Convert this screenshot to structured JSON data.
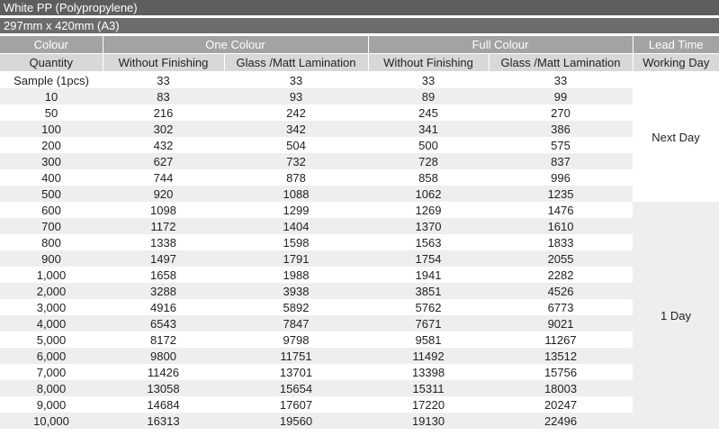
{
  "header": {
    "material": "White PP (Polypropylene)",
    "size": "297mm x 420mm (A3)"
  },
  "columns": {
    "colour_label": "Colour",
    "one_colour": "One Colour",
    "full_colour": "Full Colour",
    "lead_time": "Lead Time",
    "quantity": "Quantity",
    "without_finishing": "Without Finishing",
    "lamination": "Glass /Matt Lamination",
    "working_day": "Working Day"
  },
  "rows": [
    {
      "qty": "Sample (1pcs)",
      "one_plain": "33",
      "one_lam": "33",
      "full_plain": "33",
      "full_lam": "33"
    },
    {
      "qty": "10",
      "one_plain": "83",
      "one_lam": "93",
      "full_plain": "89",
      "full_lam": "99"
    },
    {
      "qty": "50",
      "one_plain": "216",
      "one_lam": "242",
      "full_plain": "245",
      "full_lam": "270"
    },
    {
      "qty": "100",
      "one_plain": "302",
      "one_lam": "342",
      "full_plain": "341",
      "full_lam": "386"
    },
    {
      "qty": "200",
      "one_plain": "432",
      "one_lam": "504",
      "full_plain": "500",
      "full_lam": "575"
    },
    {
      "qty": "300",
      "one_plain": "627",
      "one_lam": "732",
      "full_plain": "728",
      "full_lam": "837"
    },
    {
      "qty": "400",
      "one_plain": "744",
      "one_lam": "878",
      "full_plain": "858",
      "full_lam": "996"
    },
    {
      "qty": "500",
      "one_plain": "920",
      "one_lam": "1088",
      "full_plain": "1062",
      "full_lam": "1235"
    },
    {
      "qty": "600",
      "one_plain": "1098",
      "one_lam": "1299",
      "full_plain": "1269",
      "full_lam": "1476"
    },
    {
      "qty": "700",
      "one_plain": "1172",
      "one_lam": "1404",
      "full_plain": "1370",
      "full_lam": "1610"
    },
    {
      "qty": "800",
      "one_plain": "1338",
      "one_lam": "1598",
      "full_plain": "1563",
      "full_lam": "1833"
    },
    {
      "qty": "900",
      "one_plain": "1497",
      "one_lam": "1791",
      "full_plain": "1754",
      "full_lam": "2055"
    },
    {
      "qty": "1,000",
      "one_plain": "1658",
      "one_lam": "1988",
      "full_plain": "1941",
      "full_lam": "2282"
    },
    {
      "qty": "2,000",
      "one_plain": "3288",
      "one_lam": "3938",
      "full_plain": "3851",
      "full_lam": "4526"
    },
    {
      "qty": "3,000",
      "one_plain": "4916",
      "one_lam": "5892",
      "full_plain": "5762",
      "full_lam": "6773"
    },
    {
      "qty": "4,000",
      "one_plain": "6543",
      "one_lam": "7847",
      "full_plain": "7671",
      "full_lam": "9021"
    },
    {
      "qty": "5,000",
      "one_plain": "8172",
      "one_lam": "9798",
      "full_plain": "9581",
      "full_lam": "11267"
    },
    {
      "qty": "6,000",
      "one_plain": "9800",
      "one_lam": "11751",
      "full_plain": "11492",
      "full_lam": "13512"
    },
    {
      "qty": "7,000",
      "one_plain": "11426",
      "one_lam": "13701",
      "full_plain": "13398",
      "full_lam": "15756"
    },
    {
      "qty": "8,000",
      "one_plain": "13058",
      "one_lam": "15654",
      "full_plain": "15311",
      "full_lam": "18003"
    },
    {
      "qty": "9,000",
      "one_plain": "14684",
      "one_lam": "17607",
      "full_plain": "17220",
      "full_lam": "20247"
    },
    {
      "qty": "10,000",
      "one_plain": "16313",
      "one_lam": "19560",
      "full_plain": "19130",
      "full_lam": "22496"
    }
  ],
  "lead_times": [
    {
      "label": "Next Day",
      "rows": 8
    },
    {
      "label": "1 Day",
      "rows": 14
    }
  ]
}
